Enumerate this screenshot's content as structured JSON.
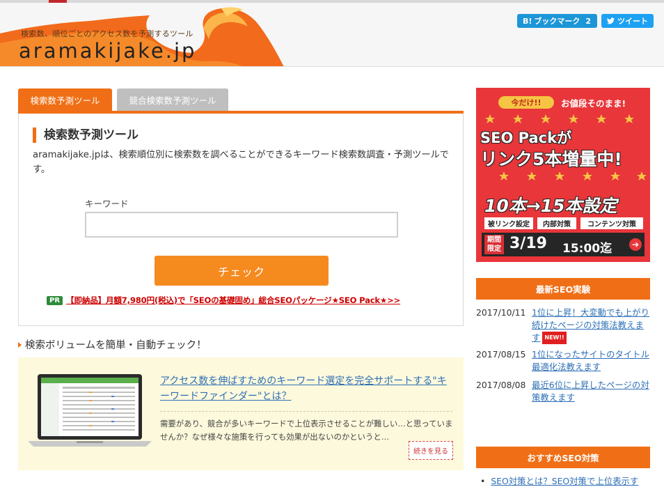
{
  "header": {
    "tagline": "検索数、順位ごとのアクセス数を予測するツール",
    "logo": "aramakijake.jp",
    "bookmark": {
      "icon_text": "B!",
      "label": "ブックマーク",
      "count": "2"
    },
    "tweet": {
      "label": "ツイート"
    }
  },
  "tabs": [
    {
      "label": "検索数予測ツール",
      "active": true
    },
    {
      "label": "競合検索数予測ツール",
      "active": false
    }
  ],
  "tool": {
    "title": "検索数予測ツール",
    "description": "aramakijake.jpは、検索順位別に検索数を調べることができるキーワード検索数調査・予測ツールです。",
    "keyword_label": "キーワード",
    "keyword_value": "",
    "check_button": "チェック",
    "pr_badge": "PR",
    "pr_link": "【即納品】月額7,980円(税込)で「SEOの基礎固め」総合SEOパッケージ★SEO Pack★>>"
  },
  "volume_section": {
    "heading": "検索ボリュームを簡単・自動チェック！",
    "article_title": "アクセス数を伸ばすためのキーワード選定を完全サポートする\"キーワードファインダー\"とは？",
    "article_excerpt": "需要があり、競合が多いキーワードで上位表示させることが難しい…と思っていませんか？なぜ様々な施策を行っても効果が出ないのかというと…",
    "more_button": "続きを見る"
  },
  "ad": {
    "pill": "今だけ!!",
    "price_text": "お値段そのまま!",
    "line1": "SEO Packが",
    "line2": "リンク5本増量中!",
    "line3": "10本→15本設定",
    "tags": [
      "被リンク設定",
      "内部対策",
      "コンテンツ対策"
    ],
    "deadline_label": "期間限定",
    "deadline_date": "3/19",
    "deadline_time": "15:00迄",
    "arrow": "➔"
  },
  "sidebar": {
    "latest_heading": "最新SEO実験",
    "news": [
      {
        "date": "2017/10/11",
        "title": "1位に上昇！大変動でも上がり続けたページの対策法教えます",
        "badge": "NEW!!"
      },
      {
        "date": "2017/08/15",
        "title": "1位になったサイトのタイトル最適化法教えます",
        "badge": ""
      },
      {
        "date": "2017/08/08",
        "title": "最近6位に上昇したページの対策教えます",
        "badge": ""
      }
    ],
    "recommend_heading": "おすすめSEO対策",
    "recommend": [
      "SEO対策とは？SEO対策で上位表示す"
    ]
  },
  "colors": {
    "accent_orange": "#f06f16",
    "button_orange": "#f58a1f",
    "link_blue": "#2d6fb6",
    "pr_green": "#2e8b3a",
    "ad_red": "#e8363a"
  }
}
